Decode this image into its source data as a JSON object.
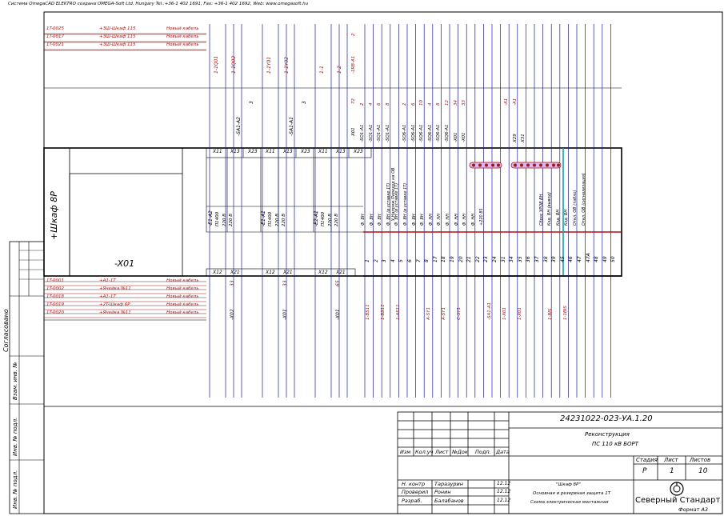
{
  "header": "Система OmegaCAD ELEKTRO создана OMEGA-Soft Ltd. Hungary Tel.:+36-1 402 1691, Fax: +36-1 402 1692, Web: www.omegasoft.hu",
  "cabinet": {
    "name": "+Шкаф 8Р",
    "terminal_block": "-X01"
  },
  "top_cables": [
    {
      "id": "1T-0025",
      "dest": "+ЗШ-Шкаф 115",
      "note": "Новый кабель"
    },
    {
      "id": "1T-0017",
      "dest": "+ЗШ-Шкаф 115",
      "note": "Новый кабель"
    },
    {
      "id": "1T-0021",
      "dest": "+ЗШ-Шкаф 115",
      "note": "Новый кабель"
    }
  ],
  "bottom_cables": [
    {
      "id": "1T-0001",
      "dest": "+A1-1T",
      "note": "Новый кабель"
    },
    {
      "id": "1T-0002",
      "dest": "+Ячейка №11",
      "note": "Новый кабель"
    },
    {
      "id": "1T-0018",
      "dest": "+A1-1T",
      "note": "Новый кабель"
    },
    {
      "id": "1T-0019",
      "dest": "+2T-Шкаф 6Р",
      "note": "Новый кабель"
    },
    {
      "id": "1T-0020",
      "dest": "+Ячейка №11",
      "note": "Новый кабель"
    }
  ],
  "sockets": [
    {
      "labels": [
        "X11",
        "X13",
        "X23"
      ],
      "top_note": "-SA1-A2",
      "top_num": "3",
      "bottom_num": "33",
      "bottom_ref": "-X02",
      "dev": "-E1-A2",
      "dev_a": "П1400",
      "dev_b": "220 В",
      "dev_c": "220 В",
      "bl": [
        "X12",
        "X21"
      ],
      "top_refs": [
        "1-1Q01",
        "1-1Q02"
      ]
    },
    {
      "labels": [
        "X11",
        "X13",
        "X23"
      ],
      "top_note": "-SA1-A1",
      "top_num": "3",
      "bottom_num": "33",
      "bottom_ref": "-X01",
      "dev": "-E1-A1",
      "dev_a": "П1400",
      "dev_b": "220 В",
      "dev_c": "220 В",
      "bl": [
        "X12",
        "X21"
      ],
      "top_refs": [
        "1-1Y01",
        "1-1Y02"
      ]
    },
    {
      "labels": [
        "X11",
        "X13",
        "X23"
      ],
      "top_note": "",
      "top_num": "",
      "bottom_num": "65",
      "bottom_ref": "-X01",
      "dev": "-E2-A1",
      "dev_a": "П1400",
      "dev_b": "220 В",
      "dev_c": "220 В",
      "bl": [
        "X12",
        "X21"
      ],
      "top_refs": [
        "1-1",
        "1-2"
      ]
    }
  ],
  "top_extra": [
    "-1RB-A1",
    "2",
    "X01",
    "72"
  ],
  "terminals": {
    "numbers": [
      "1",
      "2",
      "3",
      "4",
      "5",
      "6",
      "7",
      "8",
      "17",
      "18",
      "19",
      "20",
      "21",
      "22",
      "23",
      "24",
      "31",
      "34",
      "35",
      "36",
      "37",
      "38",
      "39",
      "45",
      "46",
      "47",
      "47A",
      "48",
      "49",
      "50"
    ],
    "top_wire": [
      "-SQ1-A1",
      "2",
      "-SQ1-A1",
      "4",
      "-SQ1-A1",
      "6",
      "-SQ1-A1",
      "8",
      "",
      "",
      "-SQ6-A1",
      "2",
      "-SQ6-A1",
      "6",
      "-SQ6-A1",
      "10",
      "-SQ6-A1",
      "4",
      "-SQ6-A1",
      "8",
      "-SQ6-A1",
      "12",
      "-X01",
      "34",
      "-X01",
      "33",
      "",
      "",
      "",
      "",
      "",
      "",
      "",
      "",
      "",
      "-A1",
      "X29",
      "-A1",
      "X31"
    ],
    "descriptions": [
      "Ф. ВН",
      "Ф. ВН",
      "Ф. ВН",
      "Ф. ВН (в уставке 1Т)",
      "Ф. ВН (в уставке 1Т)",
      "Ф. ВН (в уставке 1Т)",
      "Ф. ВН",
      "Ф. ВН",
      "Ф. НН",
      "Ф. НН",
      "Ф. НН",
      "Ф. НН",
      "Ф. НН",
      "Ф. НН",
      "+220 В1",
      "",
      "",
      "",
      "",
      "",
      "",
      "Сброс УРОВ ВН",
      "Кэд. ВН (вывод)",
      "Кэд. ВН",
      "Кэд. ВН",
      "Откл. ОВ (табло)",
      "Откл. ОВ (сигнализация)"
    ],
    "desc_vertical_1": "У.Напряж.Переход на ОВ",
    "bottom_refs": [
      "1-BS11",
      "1-BS11",
      "1-AS11",
      "",
      "A-SY1",
      "A-SY1",
      "C-SY1",
      "",
      "-SA1-A1",
      "1-X01",
      "1-X01",
      "",
      "1-BIS",
      "1-1BIS"
    ]
  },
  "title_block": {
    "doc_number": "24231022-023-УА.1.20",
    "project_line1": "Реконструкция",
    "project_line2": "ПС 110 кВ БОРТ",
    "columns": [
      "Изм",
      "Кол.уч",
      "Лист",
      "№Док",
      "Подп.",
      "Дата"
    ],
    "stage_label": "Стадия",
    "sheet_label": "Лист",
    "sheets_label": "Листов",
    "stage": "Р",
    "sheet": "1",
    "sheets": "10",
    "rows": [
      {
        "role": "Н. контр",
        "name": "Таразурин",
        "date": "12.12"
      },
      {
        "role": "Проверил",
        "name": "Ронин",
        "date": "12.12"
      },
      {
        "role": "Разраб.",
        "name": "Балабанов",
        "date": "12.12"
      }
    ],
    "sheet_title_1": "\"Шкаф 8Р\"",
    "sheet_title_2": "Основная и резервная защита 1Т",
    "sheet_title_3": "Схема электрическая монтажная",
    "company": "Северный Стандарт",
    "format": "Формат A3"
  },
  "side_stamps": [
    "Согласовано",
    "Взам. инв. №",
    "Инв. № подл.",
    "Инв. № подл."
  ]
}
